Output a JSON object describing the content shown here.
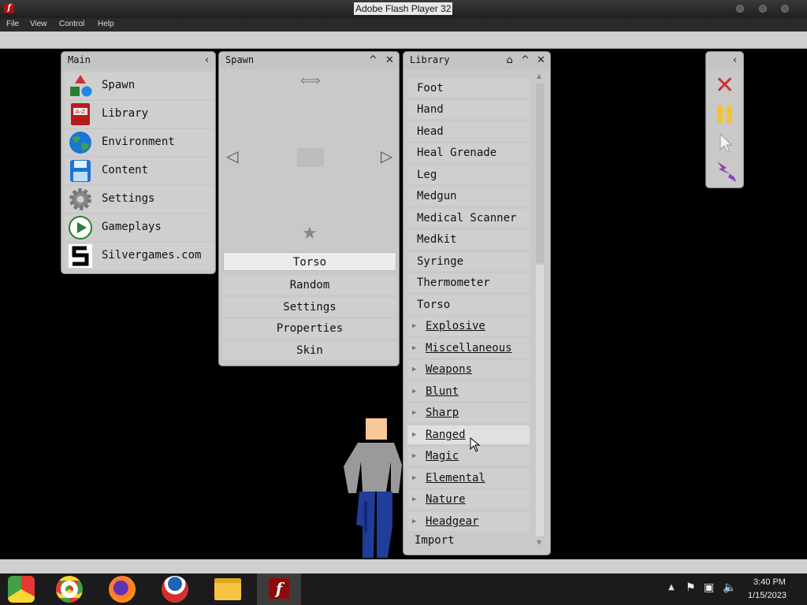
{
  "window": {
    "title": "Adobe Flash Player 32"
  },
  "menubar": {
    "items": [
      "File",
      "View",
      "Control",
      "Help"
    ]
  },
  "main_panel": {
    "title": "Main",
    "items": [
      {
        "label": "Spawn",
        "icon": "shapes-icon"
      },
      {
        "label": "Library",
        "icon": "book-icon"
      },
      {
        "label": "Environment",
        "icon": "globe-icon"
      },
      {
        "label": "Content",
        "icon": "floppy-icon"
      },
      {
        "label": "Settings",
        "icon": "gear-icon"
      },
      {
        "label": "Gameplays",
        "icon": "play-icon"
      },
      {
        "label": "Silvergames.com",
        "icon": "silvergames-logo-icon"
      }
    ]
  },
  "spawn_panel": {
    "title": "Spawn",
    "selected_item": "Torso",
    "buttons": [
      "Random",
      "Settings",
      "Properties",
      "Skin"
    ]
  },
  "library_panel": {
    "title": "Library",
    "items": [
      "Foot",
      "Hand",
      "Head",
      "Heal Grenade",
      "Leg",
      "Medgun",
      "Medical Scanner",
      "Medkit",
      "Syringe",
      "Thermometer",
      "Torso"
    ],
    "categories": [
      "Explosive",
      "Miscellaneous",
      "Weapons",
      "Blunt",
      "Sharp",
      "Ranged",
      "Magic",
      "Elemental",
      "Nature",
      "Headgear"
    ],
    "hovered_category": "Ranged",
    "import_label": "Import"
  },
  "tools_panel": {
    "items": [
      "close-red-x-icon",
      "pause-icon",
      "cursor-icon",
      "lightning-icon"
    ]
  },
  "taskbar": {
    "apps": [
      "chrome-old-icon",
      "chrome-icon",
      "firefox-icon",
      "obama-logo-icon",
      "file-explorer-icon",
      "flash-player-icon"
    ],
    "time": "3:40 PM",
    "date": "1/15/2023"
  },
  "colors": {
    "panel": "#c9c9c9",
    "row": "#cfcfcf",
    "highlight": "#e0e0e0",
    "taskbar": "#1b1b1b"
  }
}
